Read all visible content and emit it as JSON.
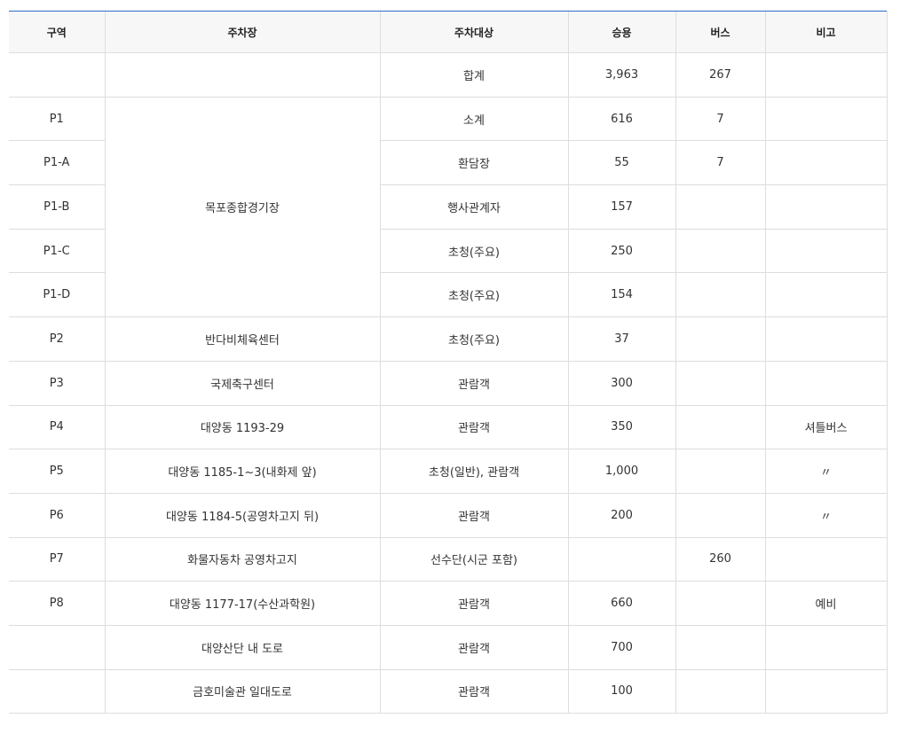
{
  "table": {
    "headers": [
      "구역",
      "주차장",
      "주차대상",
      "승용",
      "버스",
      "비고"
    ],
    "total": {
      "label": "합계",
      "car": "3,963",
      "bus": "267"
    },
    "rows": [
      {
        "zone": "P1",
        "lot": "목포종합경기장",
        "target": "소계",
        "car": "616",
        "bus": "7",
        "note": ""
      },
      {
        "zone": "P1-A",
        "lot": "",
        "target": "환담장",
        "car": "55",
        "bus": "7",
        "note": ""
      },
      {
        "zone": "P1-B",
        "lot": "",
        "target": "행사관계자",
        "car": "157",
        "bus": "",
        "note": ""
      },
      {
        "zone": "P1-C",
        "lot": "",
        "target": "초청(주요)",
        "car": "250",
        "bus": "",
        "note": ""
      },
      {
        "zone": "P1-D",
        "lot": "",
        "target": "초청(주요)",
        "car": "154",
        "bus": "",
        "note": ""
      },
      {
        "zone": "P2",
        "lot": "반다비체육센터",
        "target": "초청(주요)",
        "car": "37",
        "bus": "",
        "note": ""
      },
      {
        "zone": "P3",
        "lot": "국제축구센터",
        "target": "관람객",
        "car": "300",
        "bus": "",
        "note": ""
      },
      {
        "zone": "P4",
        "lot": "대양동 1193-29",
        "target": "관람객",
        "car": "350",
        "bus": "",
        "note": "셔틀버스"
      },
      {
        "zone": "P5",
        "lot": "대양동 1185-1~3(내화제 앞)",
        "target": "초청(일반), 관람객",
        "car": "1,000",
        "bus": "",
        "note": "〃"
      },
      {
        "zone": "P6",
        "lot": "대양동 1184-5(공영차고지 뒤)",
        "target": "관람객",
        "car": "200",
        "bus": "",
        "note": "〃"
      },
      {
        "zone": "P7",
        "lot": "화물자동차 공영차고지",
        "target": "선수단(시군 포함)",
        "car": "",
        "bus": "260",
        "note": ""
      },
      {
        "zone": "P8",
        "lot": "대양동 1177-17(수산과학원)",
        "target": "관람객",
        "car": "660",
        "bus": "",
        "note": "예비"
      },
      {
        "zone": "",
        "lot": "대양산단 내 도로",
        "target": "관람객",
        "car": "700",
        "bus": "",
        "note": ""
      },
      {
        "zone": "",
        "lot": "금호미술관 일대도로",
        "target": "관람객",
        "car": "100",
        "bus": "",
        "note": ""
      }
    ]
  }
}
